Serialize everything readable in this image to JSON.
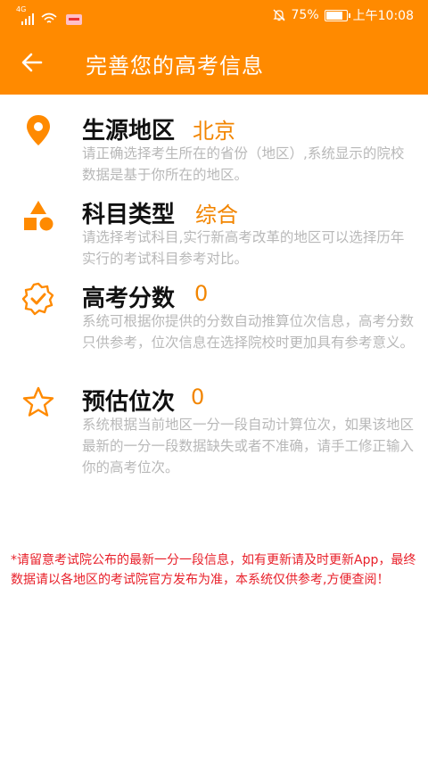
{
  "status_bar": {
    "network": "4G",
    "battery_percent": "75%",
    "battery_level": 0.75,
    "time": "上午10:08",
    "icons": [
      "signal-icon",
      "wifi-icon",
      "app-notification-icon",
      "mute-bell-icon",
      "battery-icon"
    ]
  },
  "app_bar": {
    "title": "完善您的高考信息",
    "back_icon": "back-arrow-icon"
  },
  "items": [
    {
      "icon": "location-pin-icon",
      "label": "生源地区",
      "value": "北京",
      "description": "请正确选择考生所在的省份（地区）,系统显示的院校数据是基于你所在的地区。"
    },
    {
      "icon": "shapes-icon",
      "label": "科目类型",
      "value": "综合",
      "description": "请选择考试科目,实行新高考改革的地区可以选择历年实行的考试科目参考对比。"
    },
    {
      "icon": "verified-badge-icon",
      "label": "高考分数",
      "value": "0",
      "description": "系统可根据你提供的分数自动推算位次信息，高考分数只供参考，位次信息在选择院校时更加具有参考意义。"
    },
    {
      "icon": "star-icon",
      "label": "预估位次",
      "value": "0",
      "description": "系统根据当前地区一分一段自动计算位次，如果该地区最新的一分一段数据缺失或者不准确，请手工修正输入你的高考位次。"
    }
  ],
  "notice": "*请留意考试院公布的最新一分一段信息，如有更新请及时更新App，最终数据请以各地区的考试院官方发布为准，本系统仅供参考,方便查阅！",
  "colors": {
    "primary": "#ff8a00",
    "accent_text": "#f28500",
    "description_text": "#b8b8b8",
    "notice_text": "#e8202a"
  }
}
